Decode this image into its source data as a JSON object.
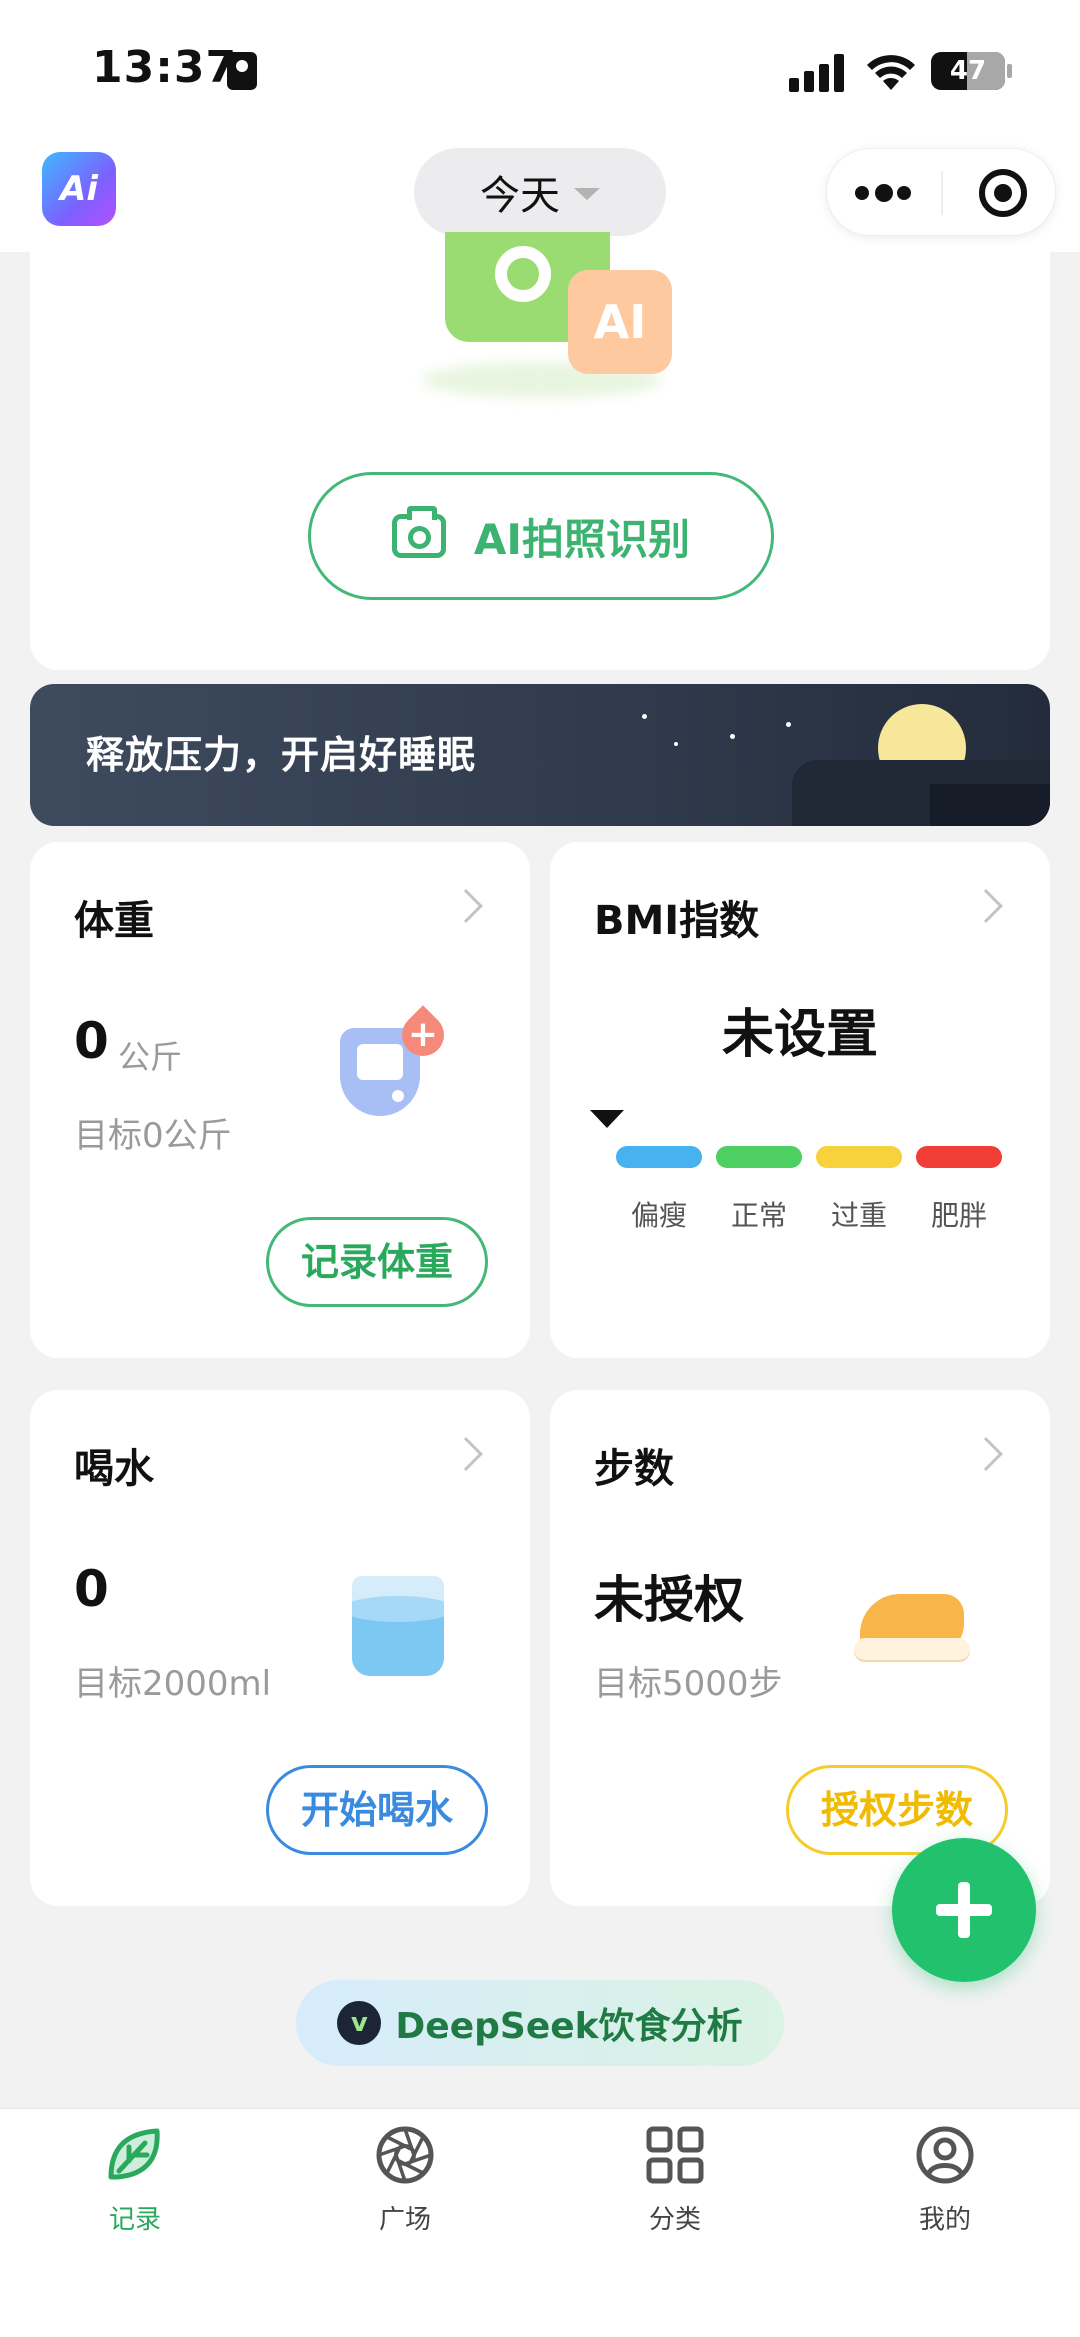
{
  "status_bar": {
    "time": "13:37",
    "battery": "47"
  },
  "nav": {
    "logo_text": "Ai",
    "date_selector": "今天"
  },
  "ai_photo": {
    "illustration_badge": "AI",
    "button_label": "AI拍照识别"
  },
  "banner": {
    "text": "释放压力，开启好睡眠"
  },
  "weight_card": {
    "title": "体重",
    "value": "0",
    "unit": "公斤",
    "target": "目标0公斤",
    "action": "记录体重",
    "badge": "+"
  },
  "bmi_card": {
    "title": "BMI指数",
    "status": "未设置",
    "categories": [
      {
        "label": "偏瘦",
        "color": "#46b2f0"
      },
      {
        "label": "正常",
        "color": "#4dd061"
      },
      {
        "label": "过重",
        "color": "#f7d23d"
      },
      {
        "label": "肥胖",
        "color": "#f03d35"
      }
    ]
  },
  "water_card": {
    "title": "喝水",
    "value": "0",
    "target": "目标2000ml",
    "action": "开始喝水"
  },
  "steps_card": {
    "title": "步数",
    "status": "未授权",
    "target": "目标5000步",
    "action": "授权步数"
  },
  "deepseek": {
    "logo_text": "v",
    "label": "DeepSeek饮食分析"
  },
  "tabbar": {
    "items": [
      {
        "label": "记录",
        "icon": "leaf-icon",
        "active": true
      },
      {
        "label": "广场",
        "icon": "aperture-icon",
        "active": false
      },
      {
        "label": "分类",
        "icon": "grid-icon",
        "active": false
      },
      {
        "label": "我的",
        "icon": "user-icon",
        "active": false
      }
    ]
  },
  "colors": {
    "brand_green": "#22c16e",
    "text_primary": "#111111",
    "text_secondary": "#9a9a9a"
  }
}
